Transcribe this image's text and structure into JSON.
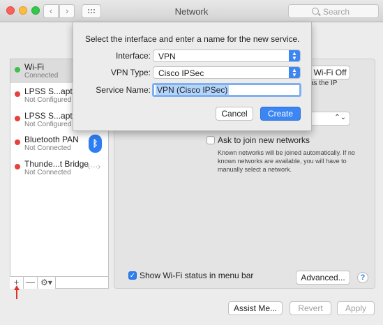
{
  "window": {
    "title": "Network",
    "search_placeholder": "Search",
    "nav_back_icon": "‹",
    "nav_forward_icon": "›"
  },
  "sidebar": {
    "services": [
      {
        "name": "Wi-Fi",
        "status": "Connected",
        "color": "#3fbf4b",
        "icon": ""
      },
      {
        "name": "LPSS S...apter",
        "status": "Not Configured",
        "color": "#e6413c",
        "icon": ""
      },
      {
        "name": "LPSS S...apter",
        "status": "Not Configured",
        "color": "#e6413c",
        "icon": ""
      },
      {
        "name": "Bluetooth PAN",
        "status": "Not Connected",
        "color": "#e6413c",
        "icon": "bluetooth-icon"
      },
      {
        "name": "Thunde...t Bridge",
        "status": "Not Connected",
        "color": "#e6413c",
        "icon": "bridge-arrows-icon"
      }
    ],
    "tools": {
      "add": "+",
      "remove": "—",
      "gear": "⚙▾"
    }
  },
  "panel": {
    "wifi_off_button": "Wi-Fi Off",
    "ip_partial_text": "as the IP",
    "ask_join_label": "Ask to join new networks",
    "ask_join_checked": false,
    "ask_join_description": "Known networks will be joined automatically. If no known networks are available, you will have to manually select a network.",
    "show_status_label": "Show Wi-Fi status in menu bar",
    "show_status_checked": true,
    "advanced_button": "Advanced...",
    "help": "?"
  },
  "footer": {
    "assist": "Assist Me...",
    "revert": "Revert",
    "apply": "Apply"
  },
  "sheet": {
    "prompt": "Select the interface and enter a name for the new service.",
    "interface_label": "Interface:",
    "interface_value": "VPN",
    "vpn_type_label": "VPN Type:",
    "vpn_type_value": "Cisco IPSec",
    "service_name_label": "Service Name:",
    "service_name_value": "VPN (Cisco IPSec)",
    "cancel": "Cancel",
    "create": "Create"
  },
  "colors": {
    "accent": "#3b86f3",
    "connected": "#3fbf4b",
    "disconnected": "#e6413c",
    "annotation_arrow": "#e0312b"
  }
}
